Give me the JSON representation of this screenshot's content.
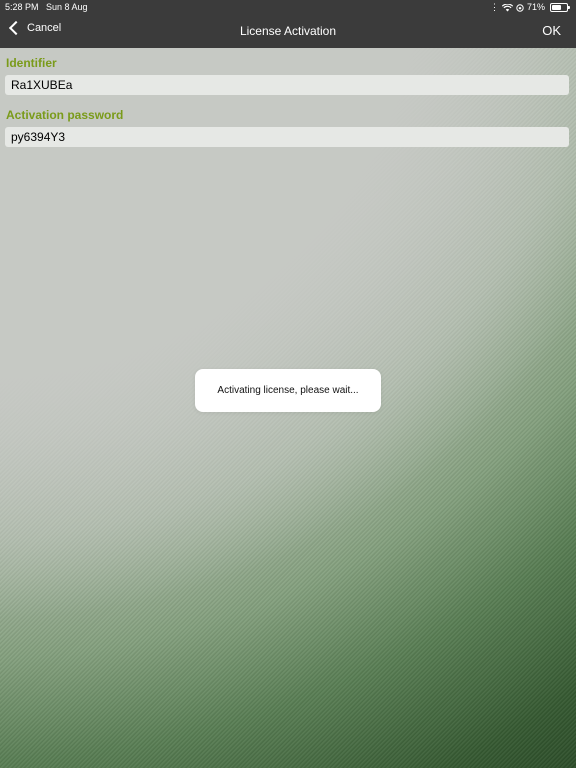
{
  "status_bar": {
    "time": "5:28 PM",
    "date": "Sun 8 Aug",
    "battery_percent": "71%",
    "battery_level": 0.71,
    "icons": [
      "signal-icon",
      "wifi-icon",
      "orientation-lock-icon"
    ]
  },
  "nav": {
    "cancel_label": "Cancel",
    "title": "License Activation",
    "ok_label": "OK"
  },
  "form": {
    "identifier_label": "Identifier",
    "identifier_value": "Ra1XUBEa",
    "password_label": "Activation password",
    "password_value": "py6394Y3"
  },
  "toast": {
    "message": "Activating license, please wait..."
  },
  "colors": {
    "accent": "#7a9b1a",
    "navbar": "#3b3b3b"
  }
}
